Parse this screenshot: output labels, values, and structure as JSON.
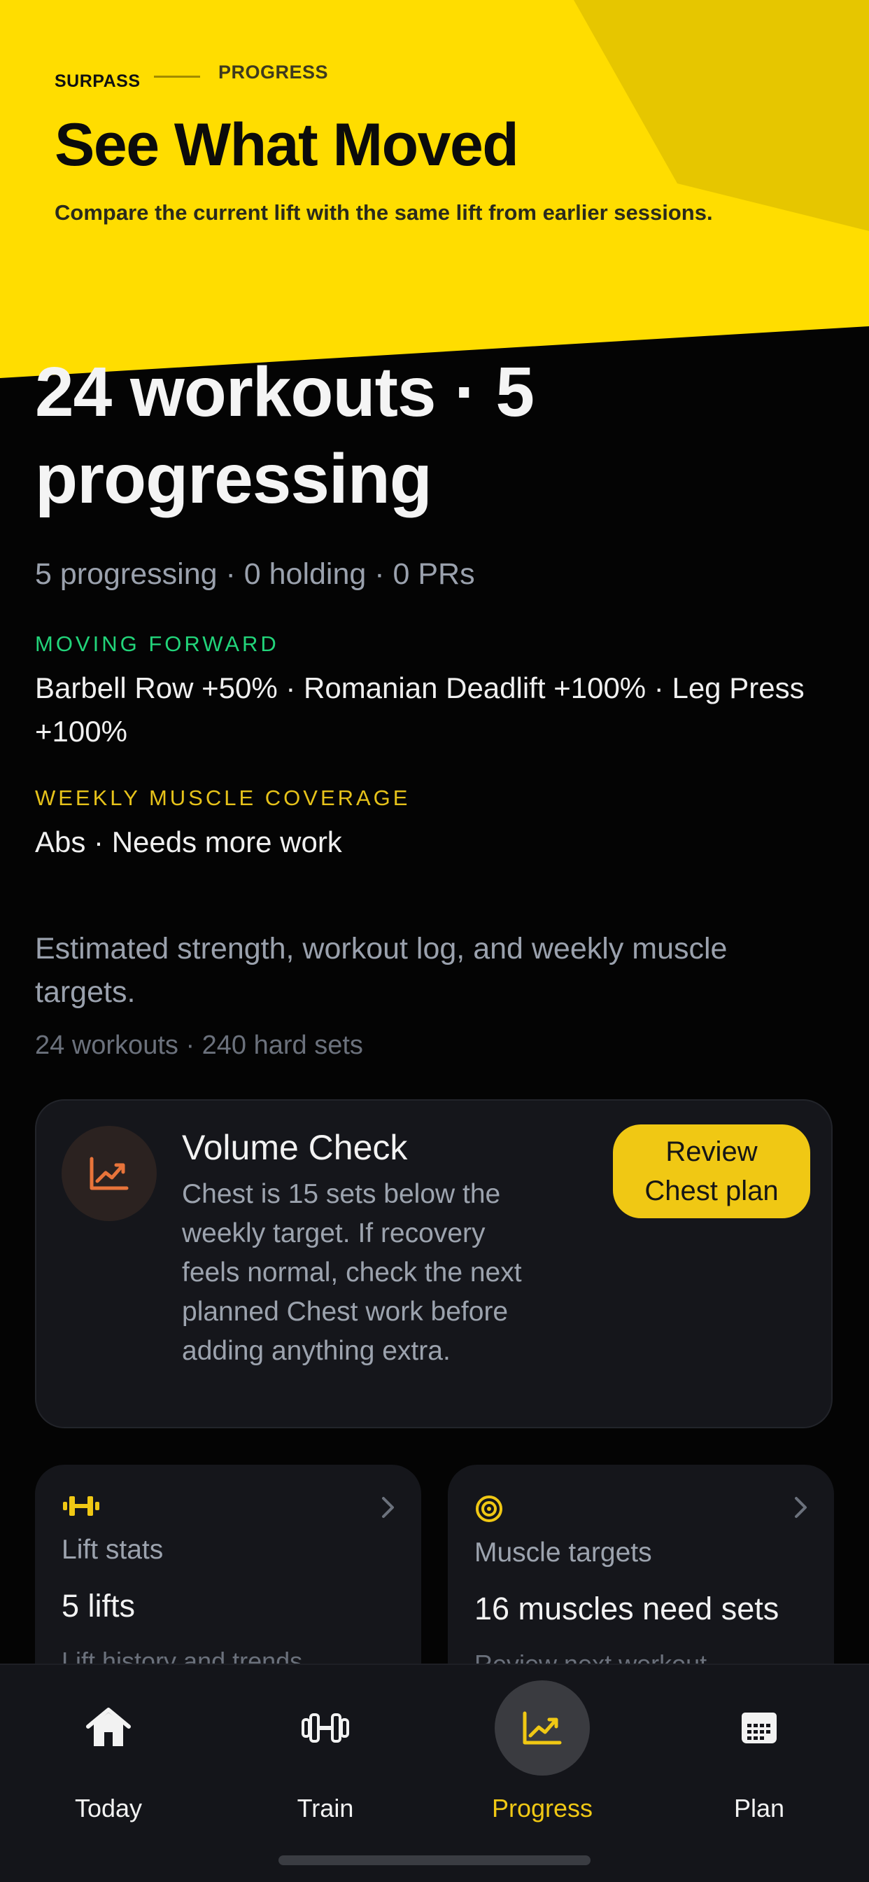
{
  "header": {
    "brand": "SURPASS",
    "section": "PROGRESS",
    "title": "See What Moved",
    "subtitle": "Compare the current lift with the same lift from earlier sessions."
  },
  "summary": {
    "title": "24 workouts · 5 progressing",
    "subtitle": "5 progressing · 0 holding · 0 PRs",
    "forward_label": "MOVING FORWARD",
    "forward_text": "Barbell Row +50% · Romanian Deadlift +100% · Leg Press +100%",
    "coverage_label": "WEEKLY MUSCLE COVERAGE",
    "coverage_text": "Abs · Needs more work",
    "description": "Estimated strength, workout log, and weekly muscle targets.",
    "meta": "24 workouts · 240 hard sets"
  },
  "volume_card": {
    "icon": "trending-up-icon",
    "title": "Volume Check",
    "body": "Chest is 15 sets below the weekly target. If recovery feels normal, check the next planned Chest work before adding anything extra.",
    "button_label": "Review Chest plan"
  },
  "cards": [
    {
      "icon": "dumbbell-icon",
      "label": "Lift stats",
      "value": "5 lifts",
      "caption": "Lift history and trends"
    },
    {
      "icon": "target-icon",
      "label": "Muscle targets",
      "value": "16 muscles need sets",
      "caption": "Review next workout"
    }
  ],
  "tabs": [
    {
      "label": "Today",
      "icon": "home-icon",
      "active": false
    },
    {
      "label": "Train",
      "icon": "dumbbell-icon",
      "active": false
    },
    {
      "label": "Progress",
      "icon": "chart-icon",
      "active": true
    },
    {
      "label": "Plan",
      "icon": "calendar-icon",
      "active": false
    }
  ],
  "colors": {
    "accent": "#f0c814",
    "header_bg": "#ffdd00",
    "success": "#22d47a",
    "background": "#040404",
    "card": "#15161b"
  }
}
